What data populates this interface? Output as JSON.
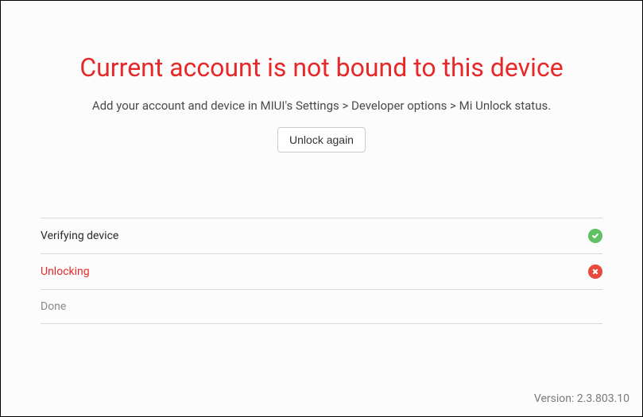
{
  "header": {
    "title": "Current account is not bound to this device",
    "subtitle": "Add your account and device in MIUI's Settings > Developer options > Mi Unlock status.",
    "button_label": "Unlock again"
  },
  "steps": [
    {
      "label": "Verifying device",
      "status": "success"
    },
    {
      "label": "Unlocking",
      "status": "error"
    },
    {
      "label": "Done",
      "status": "pending"
    }
  ],
  "footer": {
    "version_prefix": "Version: ",
    "version": "2.3.803.10"
  }
}
